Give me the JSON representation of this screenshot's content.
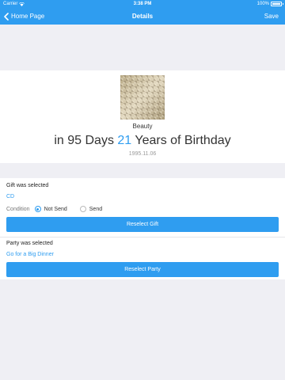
{
  "status_bar": {
    "carrier": "Carrier",
    "time": "3:38 PM",
    "battery": "100%",
    "battery_level": 1.0
  },
  "nav": {
    "back_label": "Home Page",
    "title": "Details",
    "save_label": "Save"
  },
  "profile": {
    "name": "Beauty",
    "headline_prefix": "in 95 Days",
    "headline_number": "21",
    "headline_suffix": "Years of Birthday",
    "date": "1995.11.06"
  },
  "gift": {
    "section_title": "Gift was selected",
    "selected_value": "CD",
    "condition_label": "Condition",
    "options": [
      {
        "label": "Not Send",
        "checked": true
      },
      {
        "label": "Send",
        "checked": false
      }
    ],
    "reselect_label": "Reselect Gift"
  },
  "party": {
    "section_title": "Party was selected",
    "selected_value": "Go for a Big Dinner",
    "reselect_label": "Reselect Party"
  },
  "colors": {
    "accent": "#2f9df0",
    "background": "#efeff4"
  }
}
